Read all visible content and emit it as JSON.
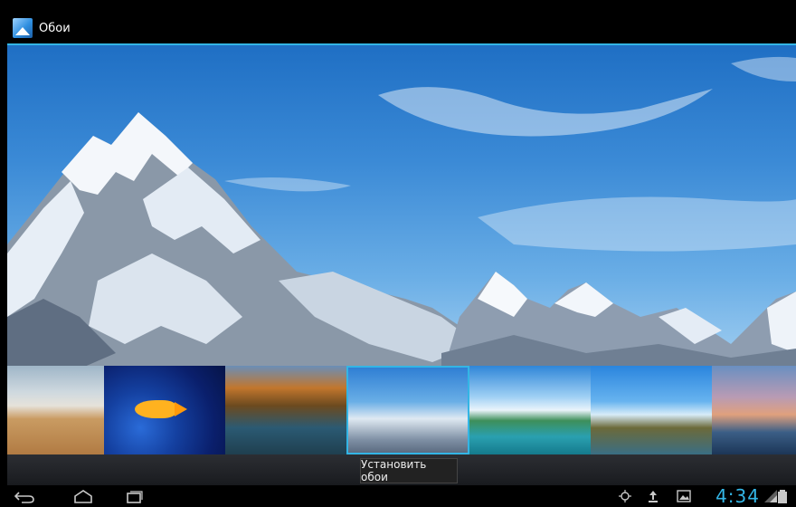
{
  "app": {
    "title": "Обои",
    "icon": "wallpaper-app-icon"
  },
  "actions": {
    "set_wallpaper_label": "Установить обои"
  },
  "thumbnails": [
    {
      "name": "beach-thumbnail"
    },
    {
      "name": "fish-thumbnail"
    },
    {
      "name": "autumn-lake-thumbnail"
    },
    {
      "name": "mountain-thumbnail",
      "selected": true
    },
    {
      "name": "tropical-island-thumbnail"
    },
    {
      "name": "coastal-tree-thumbnail"
    },
    {
      "name": "coastal-town-thumbnail"
    }
  ],
  "status_bar": {
    "clock": "4:34",
    "accent_color": "#33b5e5",
    "icons": [
      "location-icon",
      "upload-icon",
      "image-icon",
      "wifi-icon",
      "battery-icon"
    ]
  },
  "navigation": {
    "buttons": [
      "back-icon",
      "home-icon",
      "recent-apps-icon"
    ]
  }
}
